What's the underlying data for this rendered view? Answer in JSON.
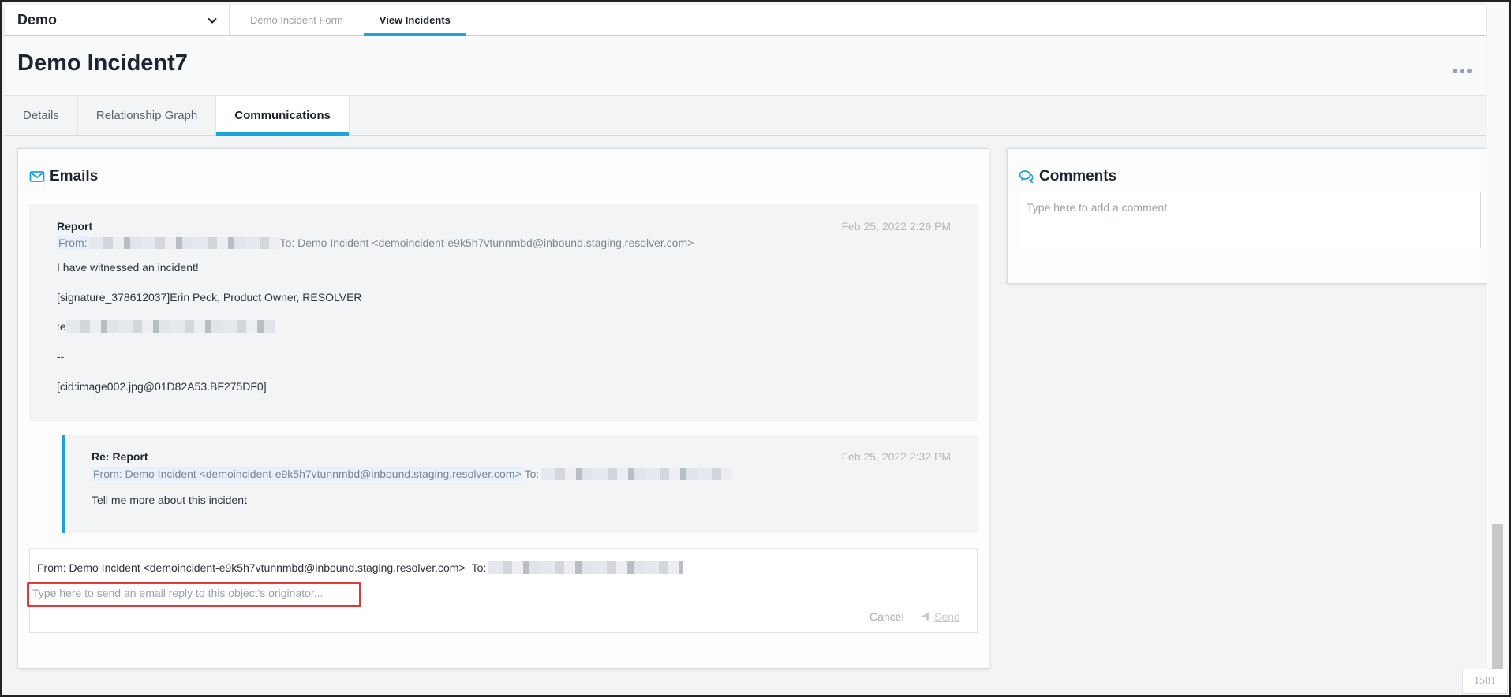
{
  "nav": {
    "app_name": "Demo",
    "tabs": [
      {
        "label": "Demo Incident Form"
      },
      {
        "label": "View Incidents"
      }
    ]
  },
  "page": {
    "title": "Demo Incident7"
  },
  "sub_tabs": [
    {
      "label": "Details"
    },
    {
      "label": "Relationship Graph"
    },
    {
      "label": "Communications"
    }
  ],
  "emails": {
    "heading": "Emails",
    "messages": [
      {
        "subject": "Report",
        "date": "Feb 25, 2022 2:26 PM",
        "from_label": "From:",
        "to_text": "To: Demo Incident <demoincident-e9k5h7vtunnmbd@inbound.staging.resolver.com>",
        "body": [
          "I have witnessed an incident!",
          "[signature_378612037]Erin Peck, Product Owner, RESOLVER",
          ":e",
          "--",
          "[cid:image002.jpg@01D82A53.BF275DF0]"
        ]
      },
      {
        "subject": "Re: Report",
        "date": "Feb 25, 2022 2:32 PM",
        "from_text": "From: Demo Incident <demoincident-e9k5h7vtunnmbd@inbound.staging.resolver.com>",
        "to_label": "To:",
        "body": [
          "Tell me more about this incident"
        ]
      }
    ],
    "reply": {
      "from_text": "From: Demo Incident <demoincident-e9k5h7vtunnmbd@inbound.staging.resolver.com>",
      "to_label": "To:",
      "placeholder": "Type here to send an email reply to this object's originator...",
      "cancel_label": "Cancel",
      "send_label": "Send"
    }
  },
  "comments": {
    "heading": "Comments",
    "placeholder": "Type here to add a comment"
  },
  "footer": {
    "page_number": "1581"
  },
  "colors": {
    "accent": "#1aa3dc",
    "highlight_border": "#e0383b"
  }
}
